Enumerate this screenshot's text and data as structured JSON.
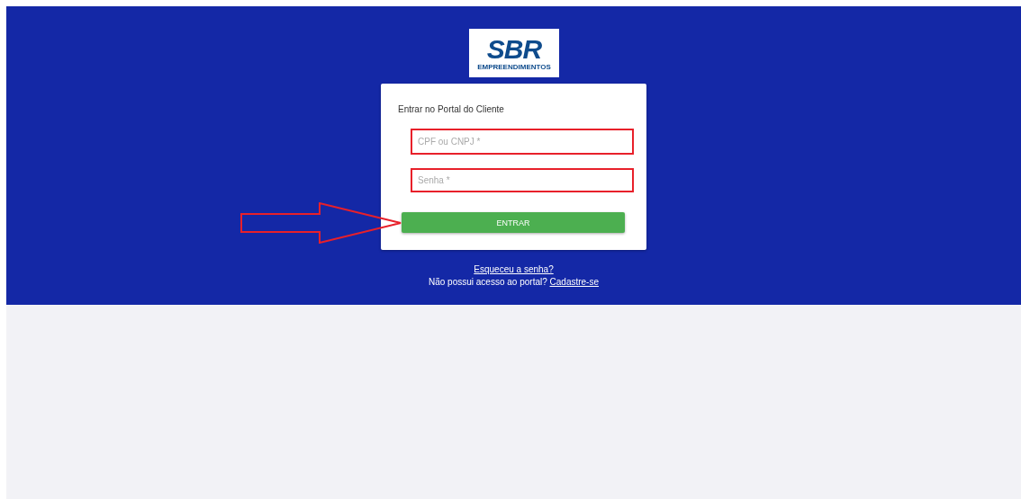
{
  "logo": {
    "name": "SBR",
    "tagline": "EMPREENDIMENTOS"
  },
  "login_card": {
    "title": "Entrar no Portal do Cliente",
    "fields": [
      {
        "placeholder": "CPF ou CNPJ *",
        "highlighted": true
      },
      {
        "placeholder": "Senha *",
        "highlighted": true
      }
    ],
    "submit_button": "ENTRAR"
  },
  "annotation": {
    "kind": "arrow"
  },
  "forgot_link": "Esqueceu a senha?",
  "signup_prompt": "Não possui acesso ao portal?",
  "signup_link": "Cadastre-se"
}
